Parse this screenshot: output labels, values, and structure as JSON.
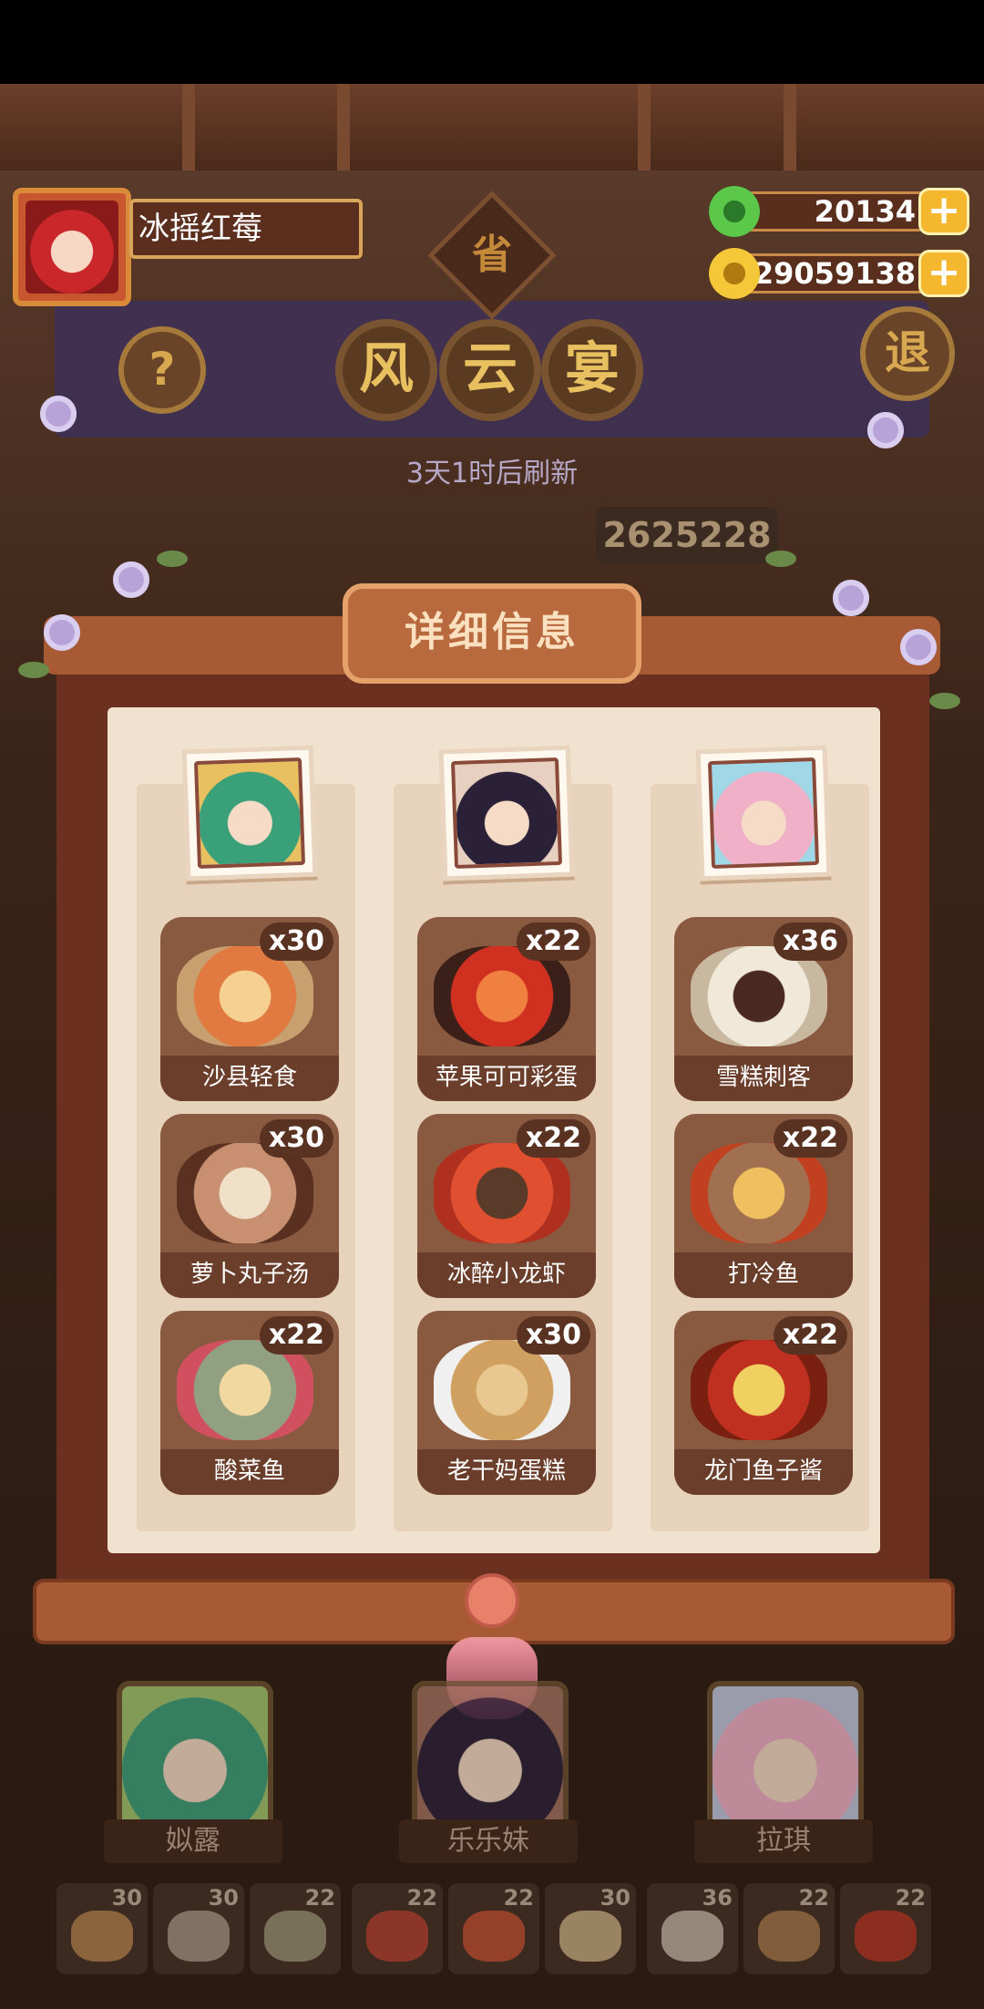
{
  "profile": {
    "name": "冰摇红莓"
  },
  "currency": {
    "jade": "20134",
    "gold": "29059138",
    "plus": "+"
  },
  "buttons": {
    "help": "?",
    "exit": "退",
    "province": "省"
  },
  "banner": {
    "title_chars": [
      "风",
      "云",
      "宴"
    ],
    "refresh": "3天1时后刷新",
    "score": "2625228"
  },
  "panel": {
    "title": "详细信息"
  },
  "columns": [
    {
      "character": "姒露",
      "dishes": [
        {
          "name": "沙县轻食",
          "count": "x30"
        },
        {
          "name": "萝卜丸子汤",
          "count": "x30"
        },
        {
          "name": "酸菜鱼",
          "count": "x22"
        }
      ]
    },
    {
      "character": "乐乐妹",
      "dishes": [
        {
          "name": "苹果可可彩蛋",
          "count": "x22"
        },
        {
          "name": "冰醉小龙虾",
          "count": "x22"
        },
        {
          "name": "老干妈蛋糕",
          "count": "x30"
        }
      ]
    },
    {
      "character": "拉琪",
      "dishes": [
        {
          "name": "雪糕刺客",
          "count": "x36"
        },
        {
          "name": "打冷鱼",
          "count": "x22"
        },
        {
          "name": "龙门鱼子酱",
          "count": "x22"
        }
      ]
    }
  ],
  "slots": [
    "30",
    "30",
    "22",
    "22",
    "22",
    "30",
    "36",
    "22",
    "22"
  ],
  "colors": {
    "accent": "#f5b72e",
    "board": "#6b3020",
    "card": "#8a5a40"
  }
}
